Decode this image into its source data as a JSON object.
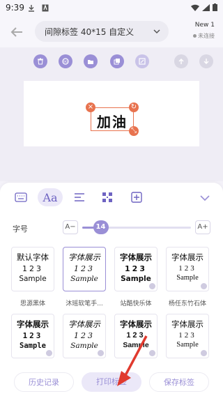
{
  "status_bar": {
    "time": "9:39"
  },
  "header": {
    "label_select": "间隙标签 40*15 自定义",
    "device_name": "New 1",
    "device_status": "未连接"
  },
  "canvas": {
    "text": "加油"
  },
  "panel": {
    "size_label": "字号",
    "size_minus": "A−",
    "size_plus": "A+",
    "font_size_value": "14",
    "font_size_fraction": 0.17,
    "fonts": [
      {
        "line1": "默认字体",
        "line2": "123",
        "line3": "Sample",
        "name": "思源黑体"
      },
      {
        "line1": "字体展示",
        "line2": "123",
        "line3": "Sample",
        "name": "沐瑶软笔手..."
      },
      {
        "line1": "字体展示",
        "line2": "123",
        "line3": "Sample",
        "name": "站酷快乐体"
      },
      {
        "line1": "字体展示",
        "line2": "123",
        "line3": "Sample",
        "name": "杨任东竹石体"
      },
      {
        "line1": "字体展示",
        "line2": "123",
        "line3": "Sample",
        "name": ""
      },
      {
        "line1": "字体展示",
        "line2": "123",
        "line3": "Sample",
        "name": ""
      },
      {
        "line1": "字体展示",
        "line2": "123",
        "line3": "Sample",
        "name": ""
      },
      {
        "line1": "字体展示",
        "line2": "123",
        "line3": "Sample",
        "name": ""
      }
    ]
  },
  "actions": {
    "history": "历史记录",
    "print": "打印标签",
    "save": "保存标签"
  },
  "colors": {
    "accent": "#9a8fd6",
    "handle": "#e8734f"
  }
}
